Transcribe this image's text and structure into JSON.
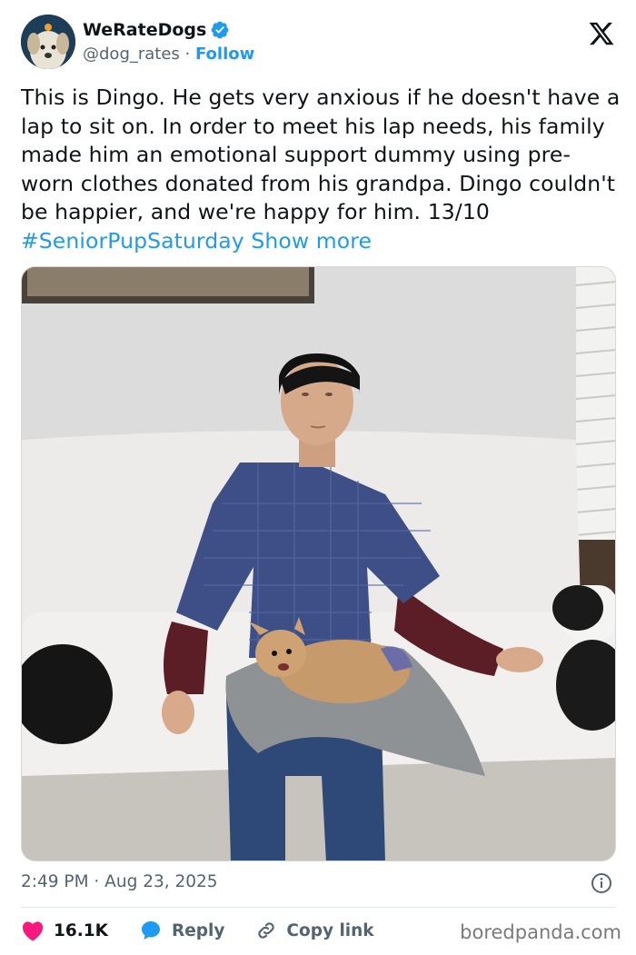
{
  "author": {
    "display_name": "WeRateDogs",
    "handle": "@dog_rates",
    "separator": " · ",
    "follow_label": "Follow"
  },
  "tweet": {
    "text": "This is Dingo. He gets very anxious if he doesn't have a lap to sit on. In order to meet his lap needs, his family made him an emotional support dummy using pre-worn clothes donated from his grandpa. Dingo couldn't be happier, and we're happy for him. 13/10 ",
    "hashtag": "#SeniorPupSaturday",
    "show_more": "Show more",
    "timestamp": "2:49 PM · Aug 23, 2025"
  },
  "actions": {
    "like_count": "16.1K",
    "reply_label": "Reply",
    "copy_link_label": "Copy link"
  },
  "watermark": "boredpanda.com",
  "colors": {
    "accent": "#1d9bf0",
    "like": "#f91880",
    "text": "#0f1419",
    "muted": "#536471"
  },
  "icons": [
    "verified-badge-icon",
    "x-logo-icon",
    "info-icon",
    "heart-icon",
    "reply-bubble-icon",
    "link-icon"
  ]
}
